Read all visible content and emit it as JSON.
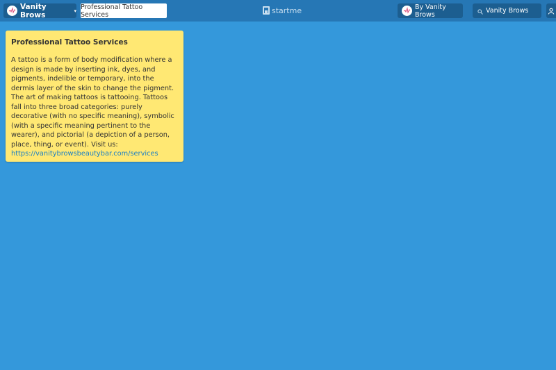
{
  "topbar": {
    "brand_label": "Vanity Brows",
    "page_title": "Professional Tattoo Services",
    "logo_text": "startme",
    "by_label": "By Vanity Brows",
    "search_value": "Vanity Brows"
  },
  "colors": {
    "background": "#3498db",
    "topbar": "#2677b5",
    "button": "#1c5e90",
    "card": "#ffe873",
    "link": "#1b7fc4"
  },
  "card": {
    "title": "Professional Tattoo Services",
    "body": "A tattoo is a form of body modification where a design is made by inserting ink, dyes, and pigments, indelible or temporary, into the dermis layer of the skin to change the pigment. The art of making tattoos is tattooing. Tattoos fall into three broad categories: purely decorative (with no specific meaning), symbolic (with a specific meaning pertinent to the wearer), and pictorial (a depiction of a person, place, thing, or event). Visit us:",
    "link": "https://vanitybrowsbeautybar.com/services"
  },
  "icons": {
    "brand": "brand-avatar-icon",
    "chevron": "chevron-down-icon",
    "logo": "startme-logo-icon",
    "search": "search-icon",
    "user": "user-icon"
  }
}
